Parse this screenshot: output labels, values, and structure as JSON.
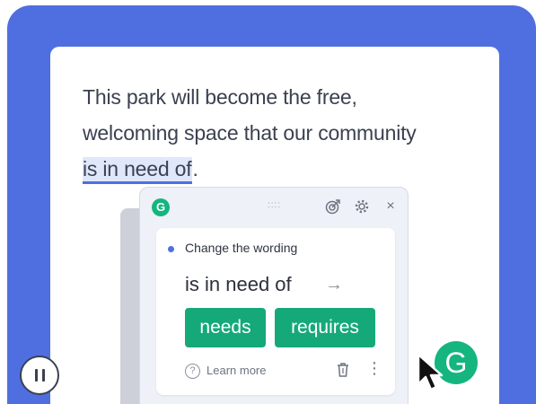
{
  "paragraph": {
    "line1": "This park will become the free,",
    "line2": "welcoming space that our community",
    "highlighted": "is in need of",
    "trailing": "."
  },
  "panel": {
    "drag_handle": "::::",
    "suggestion_title": "Change the wording",
    "original_phrase": "is in need of",
    "arrow": "→",
    "replacements": [
      "needs",
      "requires"
    ],
    "learn_more": "Learn more",
    "help_glyph": "?",
    "more_glyph": "⋮",
    "close_glyph": "×"
  },
  "brand": {
    "logo_letter": "G"
  },
  "colors": {
    "accent_blue": "#4f6fe0",
    "grammarly_green": "#15b57f",
    "chip_green": "#15a979"
  }
}
